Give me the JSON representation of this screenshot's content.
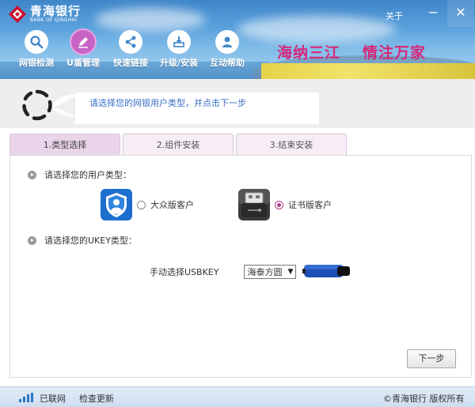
{
  "header": {
    "bank_name_cn": "青海银行",
    "bank_name_en": "BANK OF QINGHAI",
    "about_label": "关于",
    "minimize_label": "−",
    "close_label": "✕",
    "slogan_left": "海纳三江",
    "slogan_right": "情注万家"
  },
  "nav": [
    {
      "label": "网银检测",
      "icon": "search-icon",
      "active": false
    },
    {
      "label": "U盾管理",
      "icon": "pen-icon",
      "active": true
    },
    {
      "label": "快速链接",
      "icon": "share-icon",
      "active": false
    },
    {
      "label": "升级/安装",
      "icon": "download-icon",
      "active": false
    },
    {
      "label": "互动帮助",
      "icon": "user-icon",
      "active": false
    }
  ],
  "info": {
    "message": "请选择您的网银用户类型，并点击下一步"
  },
  "tabs": [
    {
      "label": "1.类型选择",
      "active": true
    },
    {
      "label": "2.组件安装",
      "active": false
    },
    {
      "label": "3.结束安装",
      "active": false
    }
  ],
  "panel": {
    "user_type_title": "请选择您的用户类型：",
    "option_public": {
      "label": "大众版客户",
      "icon": "shield-user-icon",
      "checked": false
    },
    "option_cert": {
      "label": "证书版客户",
      "icon": "usb-icon",
      "checked": true
    },
    "ukey_title": "请选择您的UKEY类型：",
    "usbkey_label": "手动选择USBKEY",
    "usbkey_selected": "海泰方圆",
    "next_label": "下一步"
  },
  "status": {
    "connected": "已联网",
    "check_update": "检查更新",
    "copyright": "©青海银行 版权所有"
  },
  "colors": {
    "accent_purple": "#c864c6",
    "slogan_pink": "#d6287a",
    "message_blue": "#3a6fc4",
    "usb_blue": "#1e4fb4"
  }
}
